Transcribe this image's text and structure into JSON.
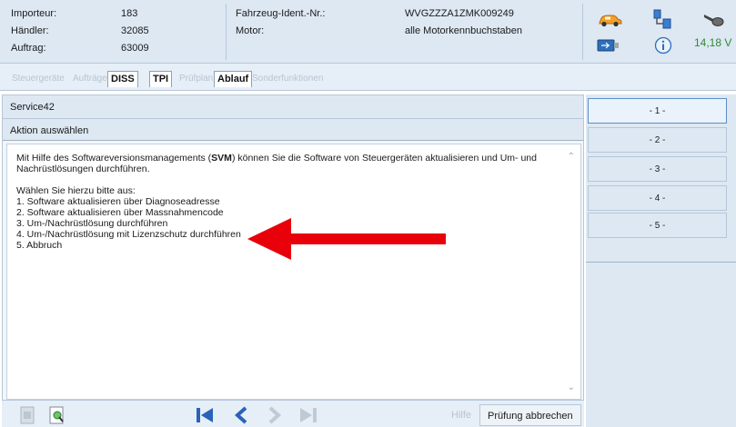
{
  "header": {
    "fields": [
      {
        "label": "Importeur:",
        "value": "183"
      },
      {
        "label": "Händler:",
        "value": "32085"
      },
      {
        "label": "Auftrag:",
        "value": "63009"
      }
    ],
    "vehicle": [
      {
        "label": "Fahrzeug-Ident.-Nr.:",
        "value": "WVGZZZA1ZMK009249"
      },
      {
        "label": "Motor:",
        "value": "alle Motorkennbuchstaben"
      }
    ],
    "voltage": "14,18 V",
    "icons": [
      "car-icon",
      "network-icon",
      "key-icon",
      "usb-icon",
      "info-icon"
    ]
  },
  "tabs": [
    {
      "label": "Steuergeräte",
      "active": false
    },
    {
      "label": "Aufträge",
      "active": false
    },
    {
      "label": "DISS",
      "active": true
    },
    {
      "label": "TPI",
      "active": true
    },
    {
      "label": "Prüfplan",
      "active": false
    },
    {
      "label": "Ablauf",
      "active": true
    },
    {
      "label": "Sonderfunktionen",
      "active": false
    }
  ],
  "panel": {
    "title": "Service42",
    "subtitle": "Aktion auswählen"
  },
  "content": {
    "intro_before": "Mit Hilfe des Softwareversionsmanagements (",
    "intro_bold": "SVM",
    "intro_after": ") können Sie die Software von Steuergeräten aktualisieren und Um- und Nachrüstlösungen durchführen.",
    "prompt": "Wählen Sie hierzu bitte aus:",
    "options": [
      "1. Software aktualisieren über Diagnoseadresse",
      "2. Software aktualisieren über Massnahmencode",
      "3. Um-/Nachrüstlösung durchführen",
      "4. Um-/Nachrüstlösung mit Lizenzschutz durchführen",
      "5. Abbruch"
    ]
  },
  "toolbar": {
    "help_label": "Hilfe",
    "abort_label": "Prüfung abbrechen"
  },
  "right_buttons": [
    "- 1 -",
    "- 2 -",
    "- 3 -",
    "- 4 -",
    "- 5 -"
  ],
  "colors": {
    "header_bg": "#dde8f3",
    "accent_arrow": "#e8000b",
    "voltage": "#2f8a2f",
    "nav_arrows": "#2a63b8"
  }
}
